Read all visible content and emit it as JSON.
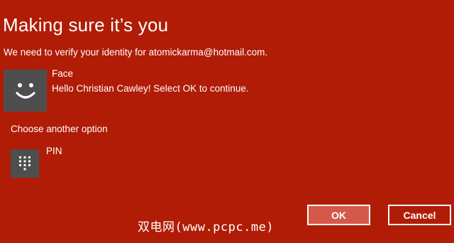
{
  "dialog": {
    "title": "Making sure it’s you",
    "subtitle": "We need to verify your identity for atomickarma@hotmail.com."
  },
  "options": {
    "face": {
      "icon": "smiley-face-icon",
      "title": "Face",
      "description": "Hello Christian Cawley! Select OK to continue."
    },
    "choose_label": "Choose another option",
    "pin": {
      "icon": "keypad-icon",
      "title": "PIN"
    }
  },
  "buttons": {
    "ok_label": "OK",
    "cancel_label": "Cancel"
  },
  "watermark": "双电网(www.pcpc.me)",
  "colors": {
    "background": "#b01c06",
    "tile": "#4e4e4e",
    "ok_button": "#d5594a",
    "text": "#ffffff"
  }
}
